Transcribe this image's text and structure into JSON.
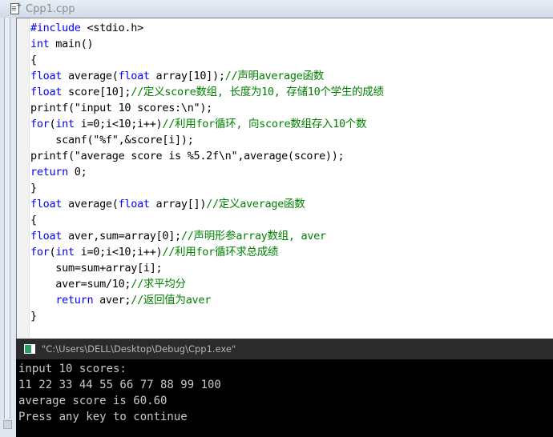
{
  "tab": {
    "label": "Cpp1.cpp",
    "icon": "cpp-file-icon"
  },
  "editor": {
    "language": "C++",
    "colors": {
      "keyword": "#0000ff",
      "comment": "#008000",
      "plain": "#000000",
      "background": "#ffffff"
    },
    "lines": [
      [
        {
          "t": "#include ",
          "c": "kw"
        },
        {
          "t": "<stdio.h>",
          "c": "pl"
        }
      ],
      [
        {
          "t": "int",
          "c": "kw"
        },
        {
          "t": " main()",
          "c": "pl"
        }
      ],
      [
        {
          "t": "{",
          "c": "pl"
        }
      ],
      [
        {
          "t": "float",
          "c": "kw"
        },
        {
          "t": " average(",
          "c": "pl"
        },
        {
          "t": "float",
          "c": "kw"
        },
        {
          "t": " array[10]);",
          "c": "pl"
        },
        {
          "t": "//声明average函数",
          "c": "cm"
        }
      ],
      [
        {
          "t": "float",
          "c": "kw"
        },
        {
          "t": " score[10];",
          "c": "pl"
        },
        {
          "t": "//定义score数组, 长度为10, 存储10个学生的成绩",
          "c": "cm"
        }
      ],
      [
        {
          "t": "printf(\"input 10 scores:\\n\");",
          "c": "pl"
        }
      ],
      [
        {
          "t": "for",
          "c": "kw"
        },
        {
          "t": "(",
          "c": "pl"
        },
        {
          "t": "int",
          "c": "kw"
        },
        {
          "t": " i=0;i<10;i++)",
          "c": "pl"
        },
        {
          "t": "//利用for循环, 向score数组存入10个数",
          "c": "cm"
        }
      ],
      [
        {
          "t": "    scanf(\"%f\",&score[i]);",
          "c": "pl"
        }
      ],
      [
        {
          "t": "printf(\"average score is %5.2f\\n\",average(score));",
          "c": "pl"
        }
      ],
      [
        {
          "t": "return",
          "c": "kw"
        },
        {
          "t": " 0;",
          "c": "pl"
        }
      ],
      [
        {
          "t": "}",
          "c": "pl"
        }
      ],
      [
        {
          "t": "float",
          "c": "kw"
        },
        {
          "t": " average(",
          "c": "pl"
        },
        {
          "t": "float",
          "c": "kw"
        },
        {
          "t": " array[])",
          "c": "pl"
        },
        {
          "t": "//定义average函数",
          "c": "cm"
        }
      ],
      [
        {
          "t": "{",
          "c": "pl"
        }
      ],
      [
        {
          "t": "float",
          "c": "kw"
        },
        {
          "t": " aver,sum=array[0];",
          "c": "pl"
        },
        {
          "t": "//声明形参array数组, aver",
          "c": "cm"
        }
      ],
      [
        {
          "t": "for",
          "c": "kw"
        },
        {
          "t": "(",
          "c": "pl"
        },
        {
          "t": "int",
          "c": "kw"
        },
        {
          "t": " i=0;i<10;i++)",
          "c": "pl"
        },
        {
          "t": "//利用for循环求总成绩",
          "c": "cm"
        }
      ],
      [
        {
          "t": "    sum=sum+array[i];",
          "c": "pl"
        }
      ],
      [
        {
          "t": "    aver=sum/10;",
          "c": "pl"
        },
        {
          "t": "//求平均分",
          "c": "cm"
        }
      ],
      [
        {
          "t": "    ",
          "c": "pl"
        },
        {
          "t": "return",
          "c": "kw"
        },
        {
          "t": " aver;",
          "c": "pl"
        },
        {
          "t": "//返回值为aver",
          "c": "cm"
        }
      ],
      [
        {
          "t": "}",
          "c": "pl"
        }
      ]
    ]
  },
  "console": {
    "title": "\"C:\\Users\\DELL\\Desktop\\Debug\\Cpp1.exe\"",
    "icon": "console-window-icon",
    "output": [
      "input 10 scores:",
      "11 22 33 44 55 66 77 88 99 100",
      "average score is 60.60",
      "Press any key to continue"
    ]
  }
}
